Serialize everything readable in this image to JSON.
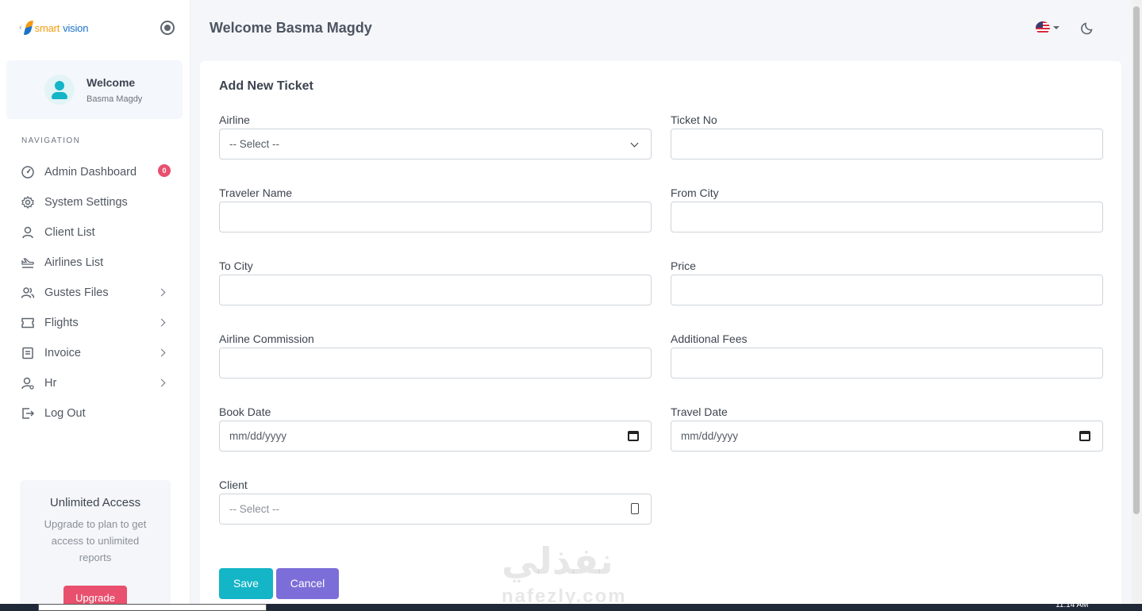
{
  "brand": {
    "part1": "smart",
    "part2": "vision"
  },
  "user": {
    "welcome": "Welcome",
    "name": "Basma Magdy"
  },
  "nav": {
    "title": "NAVIGATION",
    "items": [
      {
        "label": "Admin Dashboard",
        "icon": "dashboard-icon",
        "badge": "0"
      },
      {
        "label": "System Settings",
        "icon": "gear-icon"
      },
      {
        "label": "Client List",
        "icon": "user-icon"
      },
      {
        "label": "Airlines List",
        "icon": "plane-icon"
      },
      {
        "label": "Gustes Files",
        "icon": "users-icon",
        "arrow": true
      },
      {
        "label": "Flights",
        "icon": "ticket-icon",
        "arrow": true
      },
      {
        "label": "Invoice",
        "icon": "invoice-icon",
        "arrow": true
      },
      {
        "label": "Hr",
        "icon": "hr-icon",
        "arrow": true
      },
      {
        "label": "Log Out",
        "icon": "logout-icon"
      }
    ]
  },
  "upgrade": {
    "title": "Unlimited Access",
    "text": "Upgrade to plan to get access to unlimited reports",
    "button": "Upgrade"
  },
  "header": {
    "title": "Welcome Basma Magdy"
  },
  "form": {
    "title": "Add New Ticket",
    "airline": {
      "label": "Airline",
      "value": "-- Select --"
    },
    "ticket_no": {
      "label": "Ticket No",
      "value": ""
    },
    "traveler_name": {
      "label": "Traveler Name",
      "value": ""
    },
    "from_city": {
      "label": "From City",
      "value": ""
    },
    "to_city": {
      "label": "To City",
      "value": ""
    },
    "price": {
      "label": "Price",
      "value": ""
    },
    "airline_commission": {
      "label": "Airline Commission",
      "value": ""
    },
    "additional_fees": {
      "label": "Additional Fees",
      "value": ""
    },
    "book_date": {
      "label": "Book Date",
      "placeholder": "mm/dd/yyyy"
    },
    "travel_date": {
      "label": "Travel Date",
      "placeholder": "mm/dd/yyyy"
    },
    "client": {
      "label": "Client",
      "placeholder": "-- Select --"
    },
    "save": "Save",
    "cancel": "Cancel"
  },
  "watermark": {
    "line1": "نفذلي",
    "line2": "nafezly.com"
  },
  "taskbar": {
    "clock": "11:14 AM"
  },
  "colors": {
    "accent": "#13b5c7",
    "cancel": "#7c6ed8",
    "danger": "#e8506e"
  }
}
